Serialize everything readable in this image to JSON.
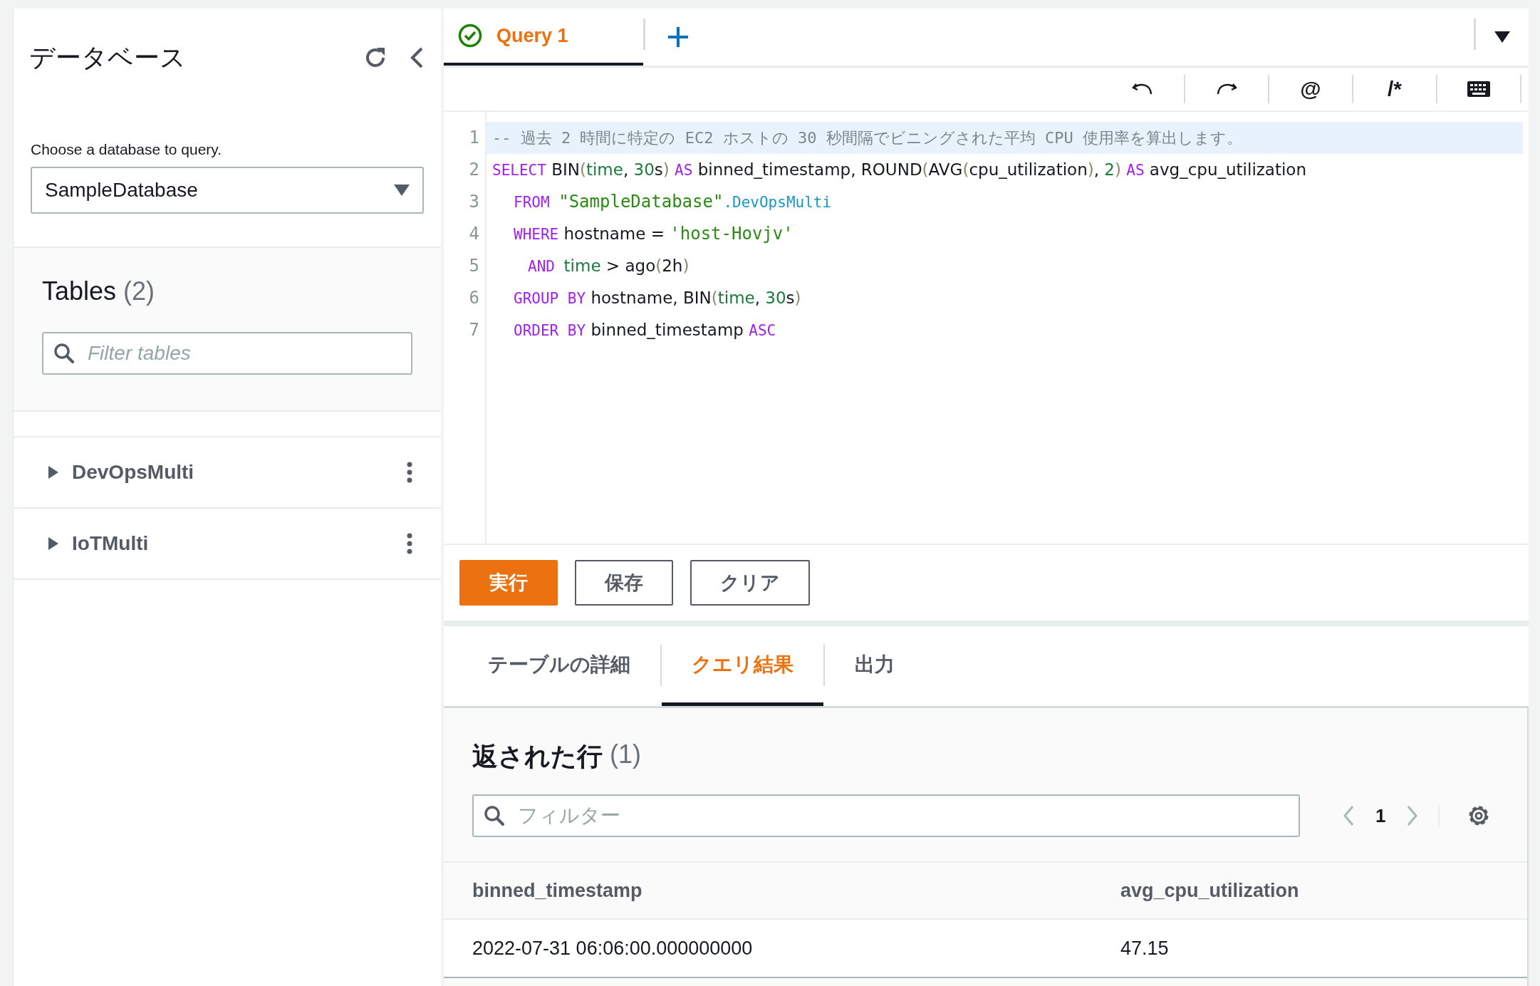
{
  "sidebar": {
    "title": "データベース",
    "select_label": "Choose a database to query.",
    "database": "SampleDatabase",
    "tables_heading": "Tables",
    "tables_count": "(2)",
    "filter": {
      "placeholder": "Filter tables"
    },
    "tables": [
      {
        "name": "DevOpsMulti",
        "expanded": false
      },
      {
        "name": "IoTMulti",
        "expanded": false
      }
    ]
  },
  "query_tabs": [
    {
      "label": "Query 1",
      "selected": true,
      "success": true
    }
  ],
  "toolbar": [
    {
      "kind": "undo"
    },
    {
      "kind": "redo"
    },
    {
      "kind": "text",
      "label": "@"
    },
    {
      "kind": "text",
      "label": "/*"
    },
    {
      "kind": "keyboard"
    }
  ],
  "editor": {
    "lines": [
      {
        "number": "1",
        "active": true,
        "kind": "statement",
        "tokens": [
          {
            "kind": "comment",
            "text": "-- 過去 2 時間に特定の EC2 ホストの 30 秒間隔でビニングされた平均 CPU 使用率を算出します。"
          }
        ]
      },
      {
        "number": "2",
        "active": false,
        "kind": "statement",
        "tokens": [
          {
            "kind": "keyword",
            "text": "SELECT"
          },
          {
            "kind": "plain",
            "text": " BIN"
          },
          {
            "kind": "paren",
            "text": "("
          },
          {
            "kind": "number",
            "text": "time"
          },
          {
            "kind": "plain",
            "text": ", "
          },
          {
            "kind": "number",
            "text": "30"
          },
          {
            "kind": "plain",
            "text": "s"
          },
          {
            "kind": "paren",
            "text": ") "
          },
          {
            "kind": "keyword",
            "text": "AS"
          },
          {
            "kind": "plain",
            "text": " binned_timestamp, ROUND"
          },
          {
            "kind": "paren",
            "text": "("
          },
          {
            "kind": "plain",
            "text": "AVG"
          },
          {
            "kind": "paren",
            "text": "("
          },
          {
            "kind": "plain",
            "text": "cpu_utilization"
          },
          {
            "kind": "paren",
            "text": ")"
          },
          {
            "kind": "plain",
            "text": ", "
          },
          {
            "kind": "number",
            "text": "2"
          },
          {
            "kind": "paren",
            "text": ") "
          },
          {
            "kind": "keyword",
            "text": "AS"
          },
          {
            "kind": "plain",
            "text": " avg_cpu_utilization"
          }
        ]
      },
      {
        "number": "3",
        "active": false,
        "kind": "clause",
        "tokens": [
          {
            "kind": "keyword",
            "text": "FROM "
          },
          {
            "kind": "string",
            "text": "\"SampleDatabase\""
          },
          {
            "kind": "table",
            "text": ".DevOpsMulti"
          }
        ]
      },
      {
        "number": "4",
        "active": false,
        "kind": "clause",
        "tokens": [
          {
            "kind": "keyword",
            "text": "WHERE"
          },
          {
            "kind": "plain",
            "text": " hostname = "
          },
          {
            "kind": "string",
            "text": "'host-Hovjv'"
          }
        ]
      },
      {
        "number": "5",
        "active": false,
        "kind": "subclause",
        "tokens": [
          {
            "kind": "keyword",
            "text": "AND "
          },
          {
            "kind": "number",
            "text": "time"
          },
          {
            "kind": "plain",
            "text": " > ago"
          },
          {
            "kind": "paren",
            "text": "("
          },
          {
            "kind": "plain",
            "text": "2h"
          },
          {
            "kind": "paren",
            "text": ")"
          }
        ]
      },
      {
        "number": "6",
        "active": false,
        "kind": "clause",
        "tokens": [
          {
            "kind": "keyword",
            "text": "GROUP BY"
          },
          {
            "kind": "plain",
            "text": " hostname, BIN"
          },
          {
            "kind": "paren",
            "text": "("
          },
          {
            "kind": "number",
            "text": "time"
          },
          {
            "kind": "plain",
            "text": ", "
          },
          {
            "kind": "number",
            "text": "30"
          },
          {
            "kind": "plain",
            "text": "s"
          },
          {
            "kind": "paren",
            "text": ")"
          }
        ]
      },
      {
        "number": "7",
        "active": false,
        "kind": "clause",
        "tokens": [
          {
            "kind": "keyword",
            "text": "ORDER BY"
          },
          {
            "kind": "plain",
            "text": " binned_timestamp "
          },
          {
            "kind": "keyword",
            "text": "ASC"
          }
        ]
      }
    ]
  },
  "actions": [
    {
      "label": "実行",
      "kind": "primary"
    },
    {
      "label": "保存",
      "kind": "normal"
    },
    {
      "label": "クリア",
      "kind": "normal"
    }
  ],
  "result_tabs": [
    {
      "label": "テーブルの詳細",
      "selected": false
    },
    {
      "label": "クエリ結果",
      "selected": true
    },
    {
      "label": "出力",
      "selected": false
    }
  ],
  "results": {
    "heading": "返された行",
    "count": "(1)",
    "filter": {
      "placeholder": "フィルター"
    },
    "page": "1",
    "table": {
      "columns": [
        "binned_timestamp",
        "avg_cpu_utilization"
      ],
      "rows": [
        [
          "2022-07-31 06:06:00.000000000",
          "47.15"
        ]
      ]
    }
  }
}
